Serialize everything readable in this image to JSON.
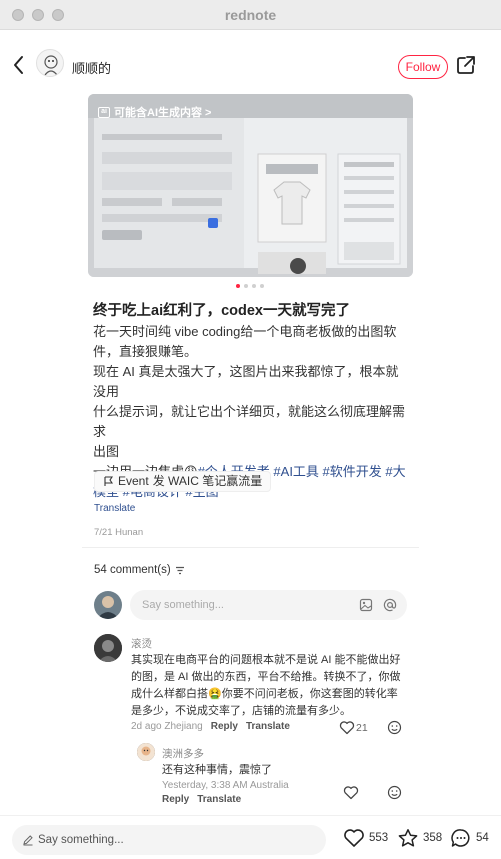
{
  "window": {
    "title": "rednote"
  },
  "header": {
    "username": "顺顺的",
    "follow_label": "Follow"
  },
  "image": {
    "ai_badge": "可能含AI生成内容 >",
    "ai_icon_text": "ai",
    "slide_index": 1,
    "slide_count": 4
  },
  "post": {
    "title": "终于吃上ai红利了，codex一天就写完了",
    "para1_line1": "花一天时间纯 vibe coding给一个电商老板做的出图软",
    "para1_line2": "件，直接狠赚笔。",
    "para2_line1": "现在 AI 真是太强大了，这图片出来我都惊了，根本就没用",
    "para2_line2": "什么提示词，就让它出个详细页，就能这么彻底理解需求",
    "para2_line3": "出图",
    "para3_prefix": "一边用一边焦虑",
    "para3_tags1": "#个人开发者 #AI工具 #软件开发 #大",
    "para3_tags2": "模型 #电商设计 #生图",
    "event_label": "Event",
    "event_text": "发 WAIC 笔记赢流量",
    "translate": "Translate",
    "meta": "7/21 Hunan"
  },
  "comments_header": {
    "count_label": "54 comment(s)"
  },
  "comment_input": {
    "placeholder": "Say something..."
  },
  "comments": [
    {
      "name": "滚烫",
      "line1": "其实现在电商平台的问题根本就不是说 AI 能不能做出好",
      "line2": "的图，是 AI 做出的东西，平台不给推。转换不了，你做",
      "line3": "成什么样都白搭🤮你要不问问老板，你这套图的转化率",
      "line4": "是多少，不说成交率了，店铺的流量有多少。",
      "time": "2d ago Zhejiang",
      "reply": "Reply",
      "translate": "Translate",
      "likes": "21"
    },
    {
      "name": "澳洲多多",
      "line1": "还有这种事情，震惊了",
      "time": "Yesterday, 3:38 AM Australia",
      "reply": "Reply",
      "translate": "Translate"
    }
  ],
  "bottom_bar": {
    "placeholder": "Say something...",
    "likes": "553",
    "stars": "358",
    "comments": "54"
  },
  "colors": {
    "accent": "#ff2442",
    "tag": "#2f4f8f"
  }
}
